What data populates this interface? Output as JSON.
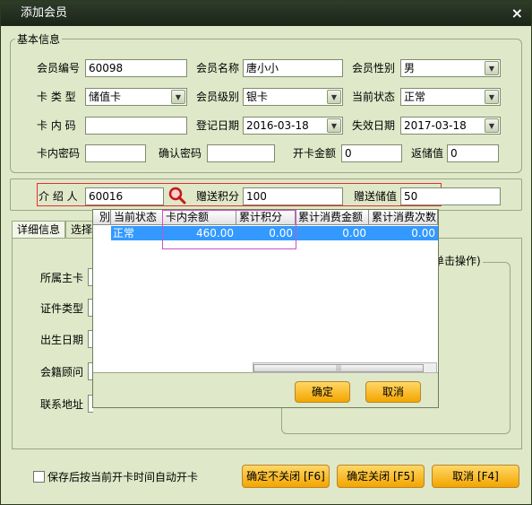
{
  "window": {
    "title": "添加会员",
    "close_glyph": "×"
  },
  "basic_info": {
    "legend": "基本信息",
    "member_no": {
      "label": "会员编号",
      "value": "60098"
    },
    "member_name": {
      "label": "会员名称",
      "value": "唐小小"
    },
    "gender": {
      "label": "会员性别",
      "value": "男"
    },
    "card_type": {
      "label": "卡 类 型",
      "value": "储值卡"
    },
    "member_level": {
      "label": "会员级别",
      "value": "银卡"
    },
    "current_status": {
      "label": "当前状态",
      "value": "正常"
    },
    "card_code": {
      "label": "卡 内 码",
      "value": ""
    },
    "reg_date": {
      "label": "登记日期",
      "value": "2016-03-18"
    },
    "expire_date": {
      "label": "失效日期",
      "value": "2017-03-18"
    },
    "card_password": {
      "label": "卡内密码",
      "value": ""
    },
    "confirm_password": {
      "label": "确认密码",
      "value": ""
    },
    "open_amount": {
      "label": "开卡金额",
      "value": "0"
    },
    "refund_value": {
      "label": "返储值",
      "value": "0"
    }
  },
  "referral": {
    "introducer": {
      "label": "介 绍 人",
      "value": "60016"
    },
    "gift_points": {
      "label": "赠送积分",
      "value": "100"
    },
    "gift_stored": {
      "label": "赠送储值",
      "value": "50"
    }
  },
  "tabs": [
    {
      "label": "详细信息"
    },
    {
      "label": "选择"
    }
  ],
  "detail": {
    "labels": [
      "所属主卡",
      "证件类型",
      "出生日期",
      "会籍顾问",
      "联系地址"
    ],
    "right_group_legend": "单击操作)"
  },
  "popup": {
    "columns": [
      "別",
      "当前状态",
      "卡内余额",
      "累计积分",
      "累计消费金额",
      "累计消费次数"
    ],
    "rows": [
      {
        "status": "正常",
        "balance": "460.00",
        "points": "0.00",
        "spend_amount": "0.00",
        "spend_count": "0.00"
      }
    ],
    "scroll_grip": "|||",
    "ok_label": "确定",
    "cancel_label": "取消"
  },
  "footer": {
    "auto_open_label": "保存后按当前开卡时间自动开卡",
    "auto_open_checked": false,
    "confirm_keep_label": "确定不关闭 [F6]",
    "confirm_close_label": "确定关闭 [F5]",
    "cancel_label": "取消 [F4]"
  },
  "icons": {
    "dropdown": "chevron-down-icon",
    "search": "magnifier-icon",
    "close": "close-icon"
  },
  "colors": {
    "accent": "#f3a500",
    "title_bar": "#1b2418",
    "selection": "#3399ff",
    "highlight_red": "#e03030",
    "highlight_pink": "#d050c8"
  }
}
